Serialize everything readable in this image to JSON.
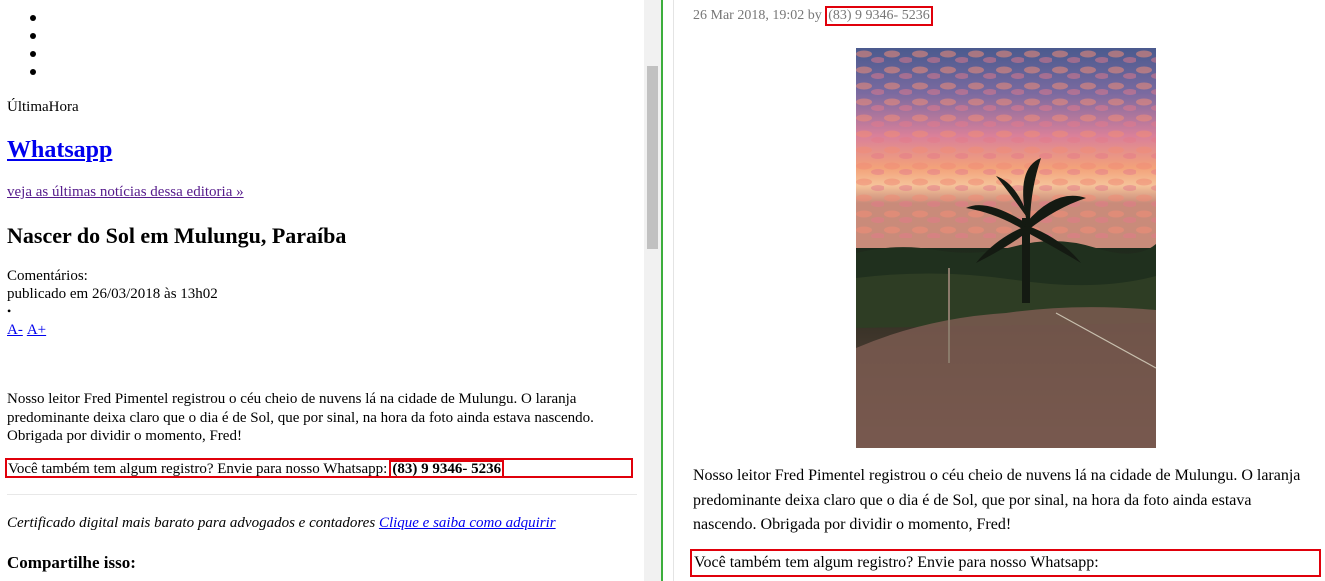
{
  "left": {
    "section_label": "ÚltimaHora",
    "editoria_link": "Whatsapp",
    "editoria_sub": "veja as últimas notícias dessa editoria »",
    "article_title": "Nascer do Sol em Mulungu, Paraíba",
    "comments_label": "Comentários:",
    "published": "publicado em 26/03/2018 às 13h02",
    "font_small": "A-",
    "font_large": "A+",
    "body": "Nosso leitor Fred Pimentel registrou o céu cheio de nuvens lá na cidade de Mulungu. O laranja predominante deixa claro que o dia é de Sol, que por sinal, na hora da foto ainda estava nascendo. Obrigada por dividir o momento, Fred!",
    "promo_text": "Você também tem algum registro? Envie para nosso Whatsapp:",
    "promo_number": "(83) 9 9346- 5236",
    "cert_text": "Certificado digital mais barato para advogados e contadores",
    "cert_link": "Clique e saiba como adquirir",
    "share_label": "Compartilhe isso:"
  },
  "right": {
    "meta_date": "26 Mar 2018, 19:02 by",
    "meta_phone": "(83) 9 9346- 5236",
    "body": "Nosso leitor Fred Pimentel registrou o céu cheio de nuvens lá na cidade de Mulungu. O laranja predominante deixa claro que o dia é de Sol, que por sinal, na hora da foto ainda estava nascendo. Obrigada por dividir o momento, Fred!",
    "promo_text": "Você também tem algum registro? Envie para nosso Whatsapp:"
  },
  "colors": {
    "highlight": "#e0000b",
    "link": "#0000ee",
    "visited": "#551a8b",
    "divider": "#3cae3c"
  }
}
